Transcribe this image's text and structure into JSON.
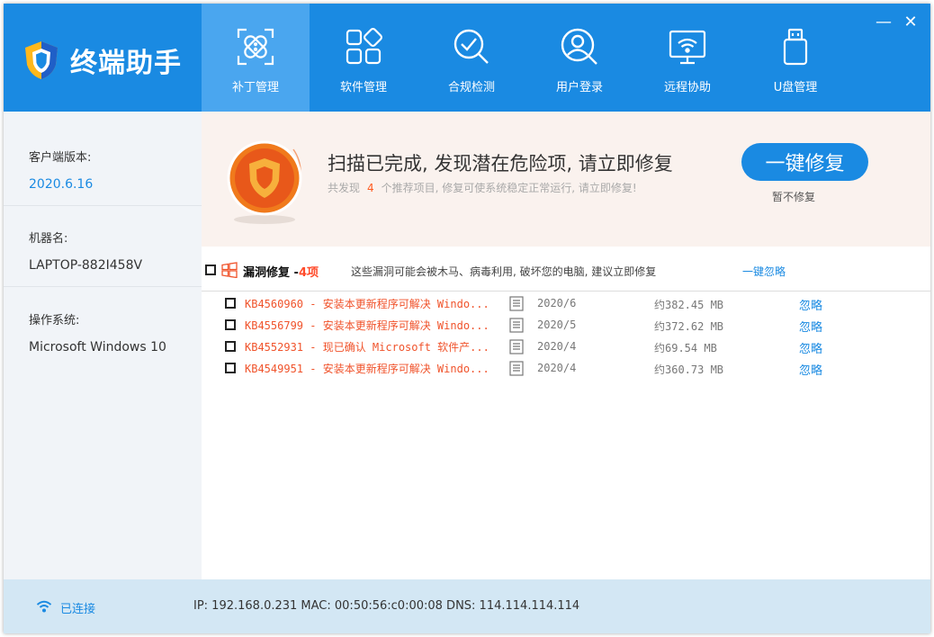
{
  "app": {
    "title": "终端助手"
  },
  "nav": {
    "items": [
      {
        "label": "补丁管理",
        "icon": "patch-icon",
        "active": true
      },
      {
        "label": "软件管理",
        "icon": "software-grid-icon",
        "active": false
      },
      {
        "label": "合规检测",
        "icon": "compliance-check-icon",
        "active": false
      },
      {
        "label": "用户登录",
        "icon": "user-login-icon",
        "active": false
      },
      {
        "label": "远程协助",
        "icon": "remote-assist-icon",
        "active": false
      },
      {
        "label": "U盘管理",
        "icon": "usb-drive-icon",
        "active": false
      }
    ]
  },
  "window_controls": {
    "minimize": "—",
    "close": "✕"
  },
  "sidebar": {
    "client_version_label": "客户端版本:",
    "client_version_value": "2020.6.16",
    "machine_name_label": "机器名:",
    "machine_name_value": "LAPTOP-882I458V",
    "os_label": "操作系统:",
    "os_value": "Microsoft Windows 10"
  },
  "scan": {
    "title": "扫描已完成, 发现潜在危险项, 请立即修复",
    "sub_prefix": "共发现",
    "sub_count": "4",
    "sub_suffix": "个推荐项目, 修复可使系统稳定正常运行, 请立即修复!",
    "fix_button": "一键修复",
    "skip_label": "暂不修复"
  },
  "section": {
    "title": "漏洞修复",
    "dash": "-",
    "count": "4项",
    "description": "这些漏洞可能会被木马、病毒利用, 破坏您的电脑, 建议立即修复",
    "ignore_all": "一键忽略"
  },
  "patches": [
    {
      "name": "KB4560960 - 安装本更新程序可解决 Windo...",
      "date": "2020/6",
      "size": "约382.45 MB",
      "ignore": "忽略"
    },
    {
      "name": "KB4556799 - 安装本更新程序可解决 Windo...",
      "date": "2020/5",
      "size": "约372.62 MB",
      "ignore": "忽略"
    },
    {
      "name": "KB4552931 - 现已确认 Microsoft 软件产...",
      "date": "2020/4",
      "size": "约69.54 MB",
      "ignore": "忽略"
    },
    {
      "name": "KB4549951 - 安装本更新程序可解决 Windo...",
      "date": "2020/4",
      "size": "约360.73 MB",
      "ignore": "忽略"
    }
  ],
  "status": {
    "connection": "已连接",
    "network_info": "IP: 192.168.0.231 MAC: 00:50:56:c0:00:08 DNS: 114.114.114.114"
  },
  "colors": {
    "header_blue": "#1a8ae2",
    "active_tab": "#4aa6ef",
    "warning_orange": "#f0532b",
    "status_bar": "#d3e7f4"
  }
}
